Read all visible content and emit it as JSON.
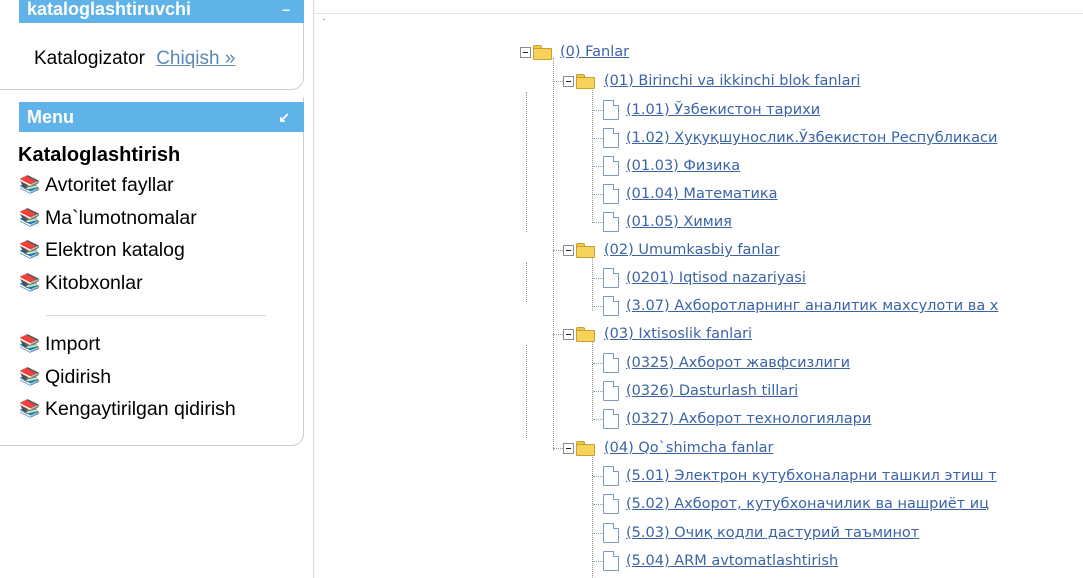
{
  "sidebar": {
    "user_panel": {
      "title": "kataloglashtiruvchi",
      "collapse_icon": "minimize-icon",
      "role": "Katalogizator",
      "logout_label": "Chiqish »"
    },
    "menu_panel": {
      "title": "Menu",
      "collapse_icon": "arrow-down-left-icon",
      "section_title": "Kataloglashtirish",
      "items_primary": [
        {
          "label": "Avtoritet fayllar",
          "icon": "books-icon"
        },
        {
          "label": "Ma`lumotnomalar",
          "icon": "books-icon"
        },
        {
          "label": "Elektron katalog",
          "icon": "books-icon"
        },
        {
          "label": "Kitobxonlar",
          "icon": "books-icon"
        }
      ],
      "items_secondary": [
        {
          "label": "Import",
          "icon": "books-icon"
        },
        {
          "label": "Qidirish",
          "icon": "books-icon"
        },
        {
          "label": "Kengaytirilgan qidirish",
          "icon": "books-icon"
        }
      ]
    }
  },
  "tree": {
    "root": {
      "label": "(0) Fanlar",
      "icon": "folder-open-icon"
    },
    "groups": [
      {
        "label": "(01) Birinchi va ikkinchi blok fanlari",
        "icon": "folder-open-icon",
        "items": [
          "(1.01) Ўзбекистон тарихи",
          "(1.02) Хуқуқшунослик.Ўзбекистон Республикаси",
          "(01.03) Физика",
          "(01.04) Математика",
          "(01.05) Химия"
        ]
      },
      {
        "label": "(02) Umumkasbiy fanlar",
        "icon": "folder-open-icon",
        "items": [
          "(0201) Iqtisod nazariyasi",
          "(3.07) Ахборотларнинг аналитик махсулоти ва х"
        ]
      },
      {
        "label": "(03) Ixtisoslik fanlari",
        "icon": "folder-open-icon",
        "items": [
          "(0325) Ахборот жавфсизлиги",
          "(0326) Dasturlash tillari",
          "(0327) Ахборот технологиялари"
        ]
      },
      {
        "label": "(04) Qo`shimcha fanlar",
        "icon": "folder-open-icon",
        "items": [
          "(5.01) Электрон кутубхоналарни ташкил этиш т",
          "(5.02) Ахборот, кутубхоначилик ва нашриёт иц",
          "(5.03) Очиқ кодли дастурий таъминот",
          "(5.04) ARM avtomatlashtirish"
        ]
      }
    ]
  },
  "colors": {
    "panel_header": "#5fb3e8",
    "link": "#3a64a6",
    "logout_link": "#5a88b8",
    "folder": "#f6d25a"
  }
}
